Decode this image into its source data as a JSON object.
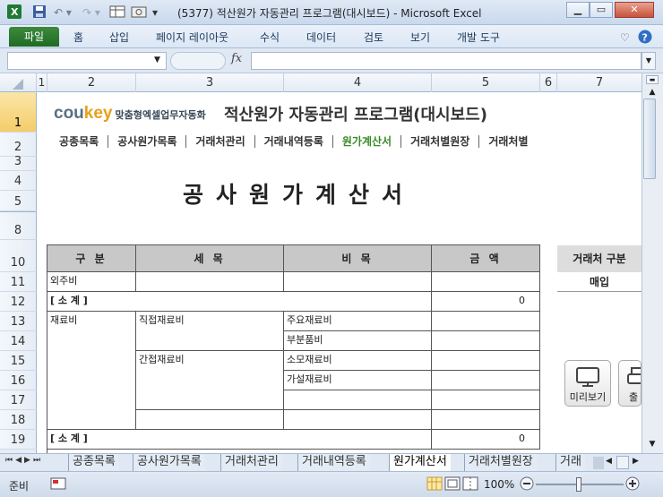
{
  "window": {
    "title": "(5377) 적산원가 자동관리 프로그램(대시보드)  -  Microsoft Excel",
    "minimize": "▁",
    "restore": "▭",
    "close": "✕"
  },
  "ribbon_tabs": [
    "파일",
    "홈",
    "삽입",
    "페이지 레이아웃",
    "수식",
    "데이터",
    "검토",
    "보기",
    "개발 도구"
  ],
  "formula_bar": {
    "fx": "fx",
    "name_value": "",
    "formula_value": ""
  },
  "columns": [
    "1",
    "2",
    "3",
    "4",
    "5",
    "6",
    "7"
  ],
  "rows": [
    "1",
    "2",
    "3",
    "4",
    "5",
    "8",
    "10",
    "11",
    "12",
    "13",
    "14",
    "15",
    "16",
    "17",
    "18",
    "19"
  ],
  "logo": {
    "part1": "cou",
    "part2": "key",
    "tagline": "맞춤형엑셀업무자동화"
  },
  "app_title": "적산원가 자동관리 프로그램(대시보드)",
  "nav": [
    "공종목록",
    "공사원가목록",
    "거래처관리",
    "거래내역등록",
    "원가계산서",
    "거래처별원장",
    "거래처별"
  ],
  "doc_title": "공사원가계산서",
  "table": {
    "headers": [
      "구 분",
      "세 목",
      "비 목",
      "금  액"
    ],
    "outsourcing": "외주비",
    "subtotal": "[ 소   계 ]",
    "subtotal_value_1": "0",
    "material": "재료비",
    "direct_material": "직접재료비",
    "indirect_material": "간접재료비",
    "main_material": "주요재료비",
    "parts": "부분품비",
    "consumables": "소모재료비",
    "temporary": "가설재료비",
    "subtotal_value_2": "0"
  },
  "side": {
    "header": "거래처 구분",
    "value": "매입",
    "preview_btn": "미리보기",
    "print_btn": "출력"
  },
  "sheet_tabs": [
    "공종목록",
    "공사원가목록",
    "거래처관리",
    "거래내역등록",
    "원가계산서",
    "거래처별원장",
    "거래"
  ],
  "status": {
    "ready": "준비",
    "zoom": "100%"
  }
}
